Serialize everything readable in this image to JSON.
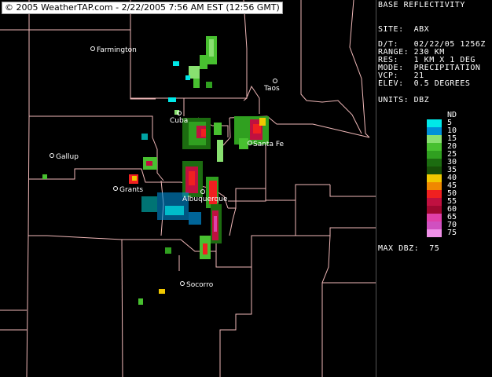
{
  "header": {
    "copyright": "© 2005 WeatherTAP.com - 2/22/2005 7:56 AM EST (12:56 GMT)"
  },
  "panel": {
    "title": "BASE REFLECTIVITY",
    "site": "SITE:  ABX",
    "dt": "D/T:   02/22/05 1256Z",
    "range": "RANGE: 230 KM",
    "res": "RES:   1 KM X 1 DEG",
    "mode": "MODE:  PRECIPITATION",
    "vcp": "VCP:   21",
    "elev": "ELEV:  0.5 DEGREES",
    "units": "UNITS: DBZ",
    "max_dbz": "MAX DBZ:  75"
  },
  "legend": [
    {
      "label": "ND",
      "color": "#000000"
    },
    {
      "label": "5",
      "color": "#00e8e8"
    },
    {
      "label": "10",
      "color": "#0090d8"
    },
    {
      "label": "15",
      "color": "#88e070"
    },
    {
      "label": "20",
      "color": "#48c030"
    },
    {
      "label": "25",
      "color": "#30a020"
    },
    {
      "label": "30",
      "color": "#1c6c10"
    },
    {
      "label": "35",
      "color": "#185008"
    },
    {
      "label": "40",
      "color": "#f0c800"
    },
    {
      "label": "45",
      "color": "#f08800"
    },
    {
      "label": "50",
      "color": "#f02020"
    },
    {
      "label": "55",
      "color": "#c01040"
    },
    {
      "label": "60",
      "color": "#a00830"
    },
    {
      "label": "65",
      "color": "#e040a8"
    },
    {
      "label": "70",
      "color": "#d050c0"
    },
    {
      "label": "75",
      "color": "#f090e8"
    }
  ],
  "cities": [
    {
      "name": "Farmington"
    },
    {
      "name": "Taos"
    },
    {
      "name": "Cuba"
    },
    {
      "name": "Santa Fe"
    },
    {
      "name": "Gallup"
    },
    {
      "name": "Grants"
    },
    {
      "name": "Albuquerque"
    },
    {
      "name": "Socorro"
    }
  ]
}
